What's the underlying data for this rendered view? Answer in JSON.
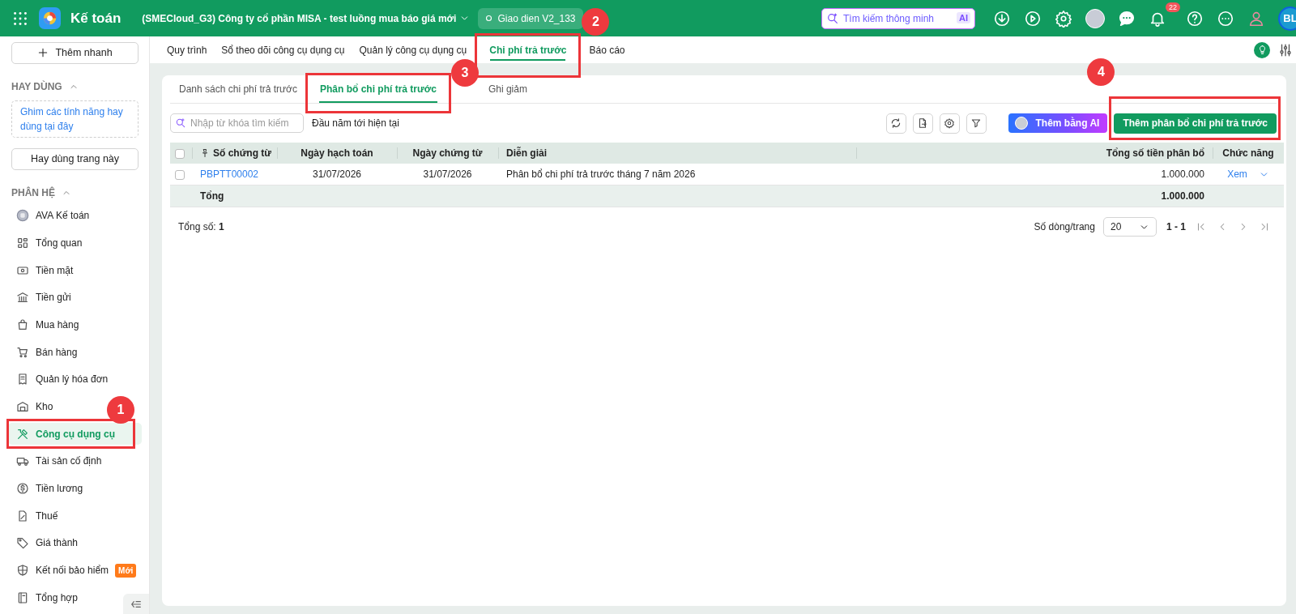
{
  "header": {
    "app_name": "Kế toán",
    "company": "(SMECloud_G3) Công ty cổ phần MISA - test luồng mua báo giá mới",
    "version": "Giao dien V2_133",
    "search_placeholder": "Tìm kiếm thông minh",
    "ai_label": "AI",
    "notification_count": "22",
    "avatar_initials": "BL"
  },
  "sidebar": {
    "quick_add": "Thêm nhanh",
    "favorites_title": "HAY DÙNG",
    "favorites_hint": "Ghim các tính năng hay dùng tại đây",
    "favorite_page_button": "Hay dùng trang này",
    "modules_title": "PHÂN HỆ",
    "items": [
      {
        "label": "AVA Kế toán",
        "selected": false
      },
      {
        "label": "Tổng quan",
        "selected": false
      },
      {
        "label": "Tiền mặt",
        "selected": false
      },
      {
        "label": "Tiền gửi",
        "selected": false
      },
      {
        "label": "Mua hàng",
        "selected": false
      },
      {
        "label": "Bán hàng",
        "selected": false
      },
      {
        "label": "Quản lý hóa đơn",
        "selected": false
      },
      {
        "label": "Kho",
        "selected": false
      },
      {
        "label": "Công cụ dụng cụ",
        "selected": true,
        "step": "1"
      },
      {
        "label": "Tài sản cố định",
        "selected": false
      },
      {
        "label": "Tiền lương",
        "selected": false
      },
      {
        "label": "Thuế",
        "selected": false
      },
      {
        "label": "Giá thành",
        "selected": false
      },
      {
        "label": "Kết nối bảo hiểm",
        "selected": false,
        "badge": "Mới"
      },
      {
        "label": "Tổng hợp",
        "selected": false
      }
    ]
  },
  "top_tabs": [
    {
      "label": "Quy trình",
      "selected": false
    },
    {
      "label": "Sổ theo dõi công cụ dụng cụ",
      "selected": false
    },
    {
      "label": "Quản lý công cụ dụng cụ",
      "selected": false
    },
    {
      "label": "Chi phí trả trước",
      "selected": true,
      "step": "2"
    },
    {
      "label": "Báo cáo",
      "selected": false
    }
  ],
  "sub_tabs": [
    {
      "label": "Danh sách chi phí trả trước",
      "selected": false
    },
    {
      "label": "Phân bổ chi phí trả trước",
      "selected": true,
      "step": "3"
    },
    {
      "label": "Ghi giảm",
      "selected": false
    }
  ],
  "toolbar": {
    "search_placeholder": "Nhập từ khóa tìm kiếm",
    "period": "Đầu năm tới hiện tại",
    "ai_button": "Thêm bằng AI",
    "add_button": "Thêm phân bổ chi phí trả trước",
    "add_button_step": "4"
  },
  "table": {
    "select_all_checked": false,
    "columns": [
      "Số chứng từ",
      "Ngày hạch toán",
      "Ngày chứng từ",
      "Diễn giải",
      "Tổng số tiền phân bổ",
      "Chức năng"
    ],
    "rows": [
      {
        "checked": false,
        "cells": [
          "PBPTT00002",
          "31/07/2026",
          "31/07/2026",
          "Phân bổ chi phí trả trước tháng 7 năm 2026",
          "1.000.000"
        ],
        "action": "Xem"
      }
    ],
    "total": {
      "label": "Tổng",
      "amount": "1.000.000"
    }
  },
  "footer": {
    "count_label": "Tổng số:",
    "count": "1",
    "page_size_label": "Số dòng/trang",
    "page_size": "20",
    "range": "1 - 1"
  }
}
